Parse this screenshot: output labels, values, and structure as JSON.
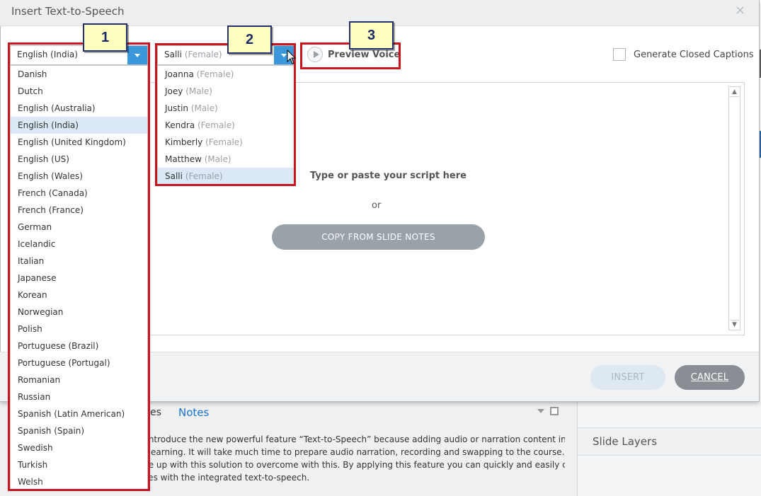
{
  "dialog": {
    "title": "Insert Text-to-Speech",
    "close_glyph": "×",
    "generate_captions_label": "Generate Closed Captions",
    "preview_label": "Preview Voice",
    "script_placeholder": "Type or paste your script here",
    "or_label": "or",
    "copy_button": "COPY FROM SLIDE NOTES",
    "insert_button": "INSERT",
    "cancel_button": "CANCEL"
  },
  "language": {
    "selected": "English (India)",
    "options": [
      "Danish",
      "Dutch",
      "English (Australia)",
      "English (India)",
      "English (United Kingdom)",
      "English (US)",
      "English (Wales)",
      "French (Canada)",
      "French (France)",
      "German",
      "Icelandic",
      "Italian",
      "Japanese",
      "Korean",
      "Norwegian",
      "Polish",
      "Portuguese (Brazil)",
      "Portuguese (Portugal)",
      "Romanian",
      "Russian",
      "Spanish (Latin American)",
      "Spanish (Spain)",
      "Swedish",
      "Turkish",
      "Welsh"
    ]
  },
  "voice": {
    "selected_name": "Salli",
    "selected_gender": "(Female)",
    "options": [
      {
        "name": "Joanna",
        "gender": "(Female)"
      },
      {
        "name": "Joey",
        "gender": "(Male)"
      },
      {
        "name": "Justin",
        "gender": "(Male)"
      },
      {
        "name": "Kendra",
        "gender": "(Female)"
      },
      {
        "name": "Kimberly",
        "gender": "(Female)"
      },
      {
        "name": "Matthew",
        "gender": "(Male)"
      },
      {
        "name": "Salli",
        "gender": "(Female)"
      }
    ]
  },
  "callouts": [
    "1",
    "2",
    "3"
  ],
  "background": {
    "tab_partial": "es",
    "tab_notes": "Notes",
    "slide_layers": "Slide Layers",
    "notes_lines": [
      ") introduce the new powerful feature “Text-to-Speech” because adding audio or narration content in the",
      "e-learning. It will take much time to prepare audio narration, recording and swapping to the course. Now",
      "me up with this solution to overcome with this. By applying this feature you can quickly and easily create",
      "rses with the integrated text-to-speech."
    ]
  },
  "colors": {
    "accent": "#3a97d9",
    "highlight": "#c8151d",
    "badge_fill": "#ffffc0"
  }
}
